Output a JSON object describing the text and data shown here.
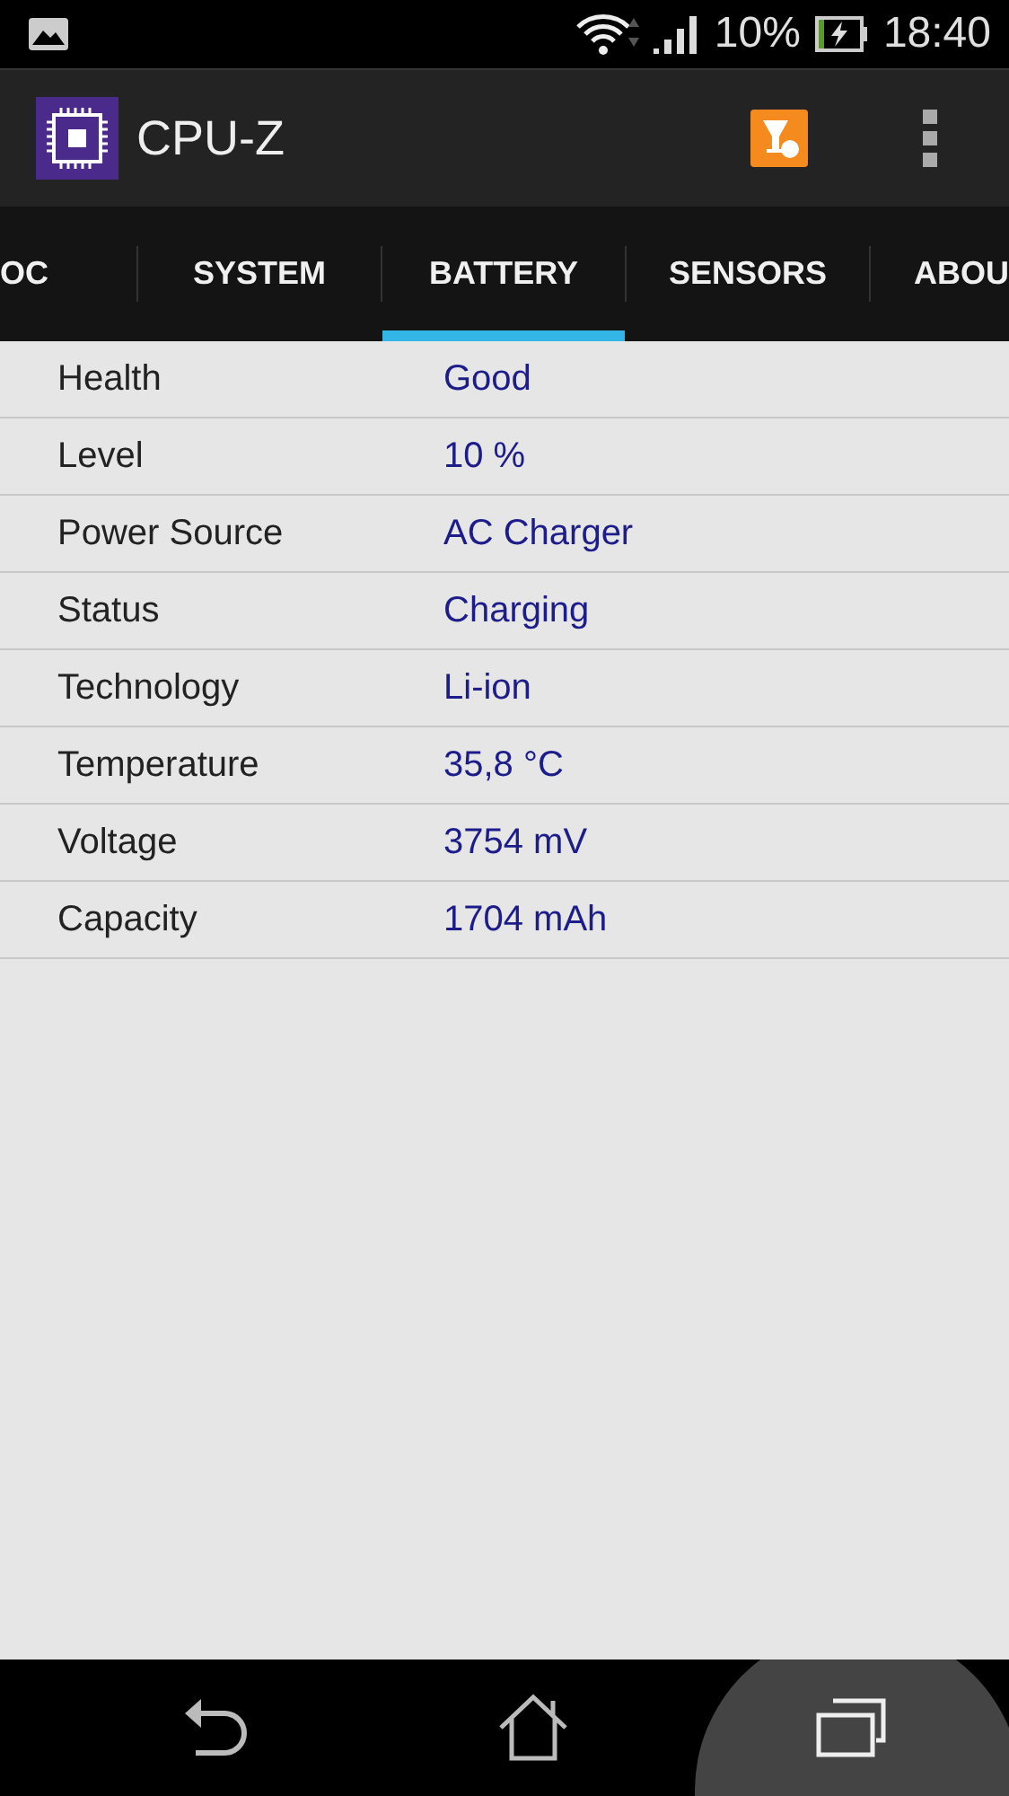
{
  "status_bar": {
    "battery_percent": "10%",
    "time": "18:40"
  },
  "app_bar": {
    "title": "CPU-Z"
  },
  "tabs": [
    {
      "label": "OC",
      "selected": false
    },
    {
      "label": "SYSTEM",
      "selected": false
    },
    {
      "label": "BATTERY",
      "selected": true
    },
    {
      "label": "SENSORS",
      "selected": false
    },
    {
      "label": "ABOU",
      "selected": false
    }
  ],
  "rows": [
    {
      "label": "Health",
      "value": "Good"
    },
    {
      "label": "Level",
      "value": "10 %"
    },
    {
      "label": "Power Source",
      "value": "AC Charger"
    },
    {
      "label": "Status",
      "value": "Charging"
    },
    {
      "label": "Technology",
      "value": "Li-ion"
    },
    {
      "label": "Temperature",
      "value": "35,8 °C"
    },
    {
      "label": "Voltage",
      "value": "3754 mV"
    },
    {
      "label": "Capacity",
      "value": "1704 mAh"
    }
  ],
  "nav_bar": [
    {
      "kind": "back",
      "pressed": false
    },
    {
      "kind": "home",
      "pressed": false
    },
    {
      "kind": "recents",
      "pressed": true
    }
  ]
}
